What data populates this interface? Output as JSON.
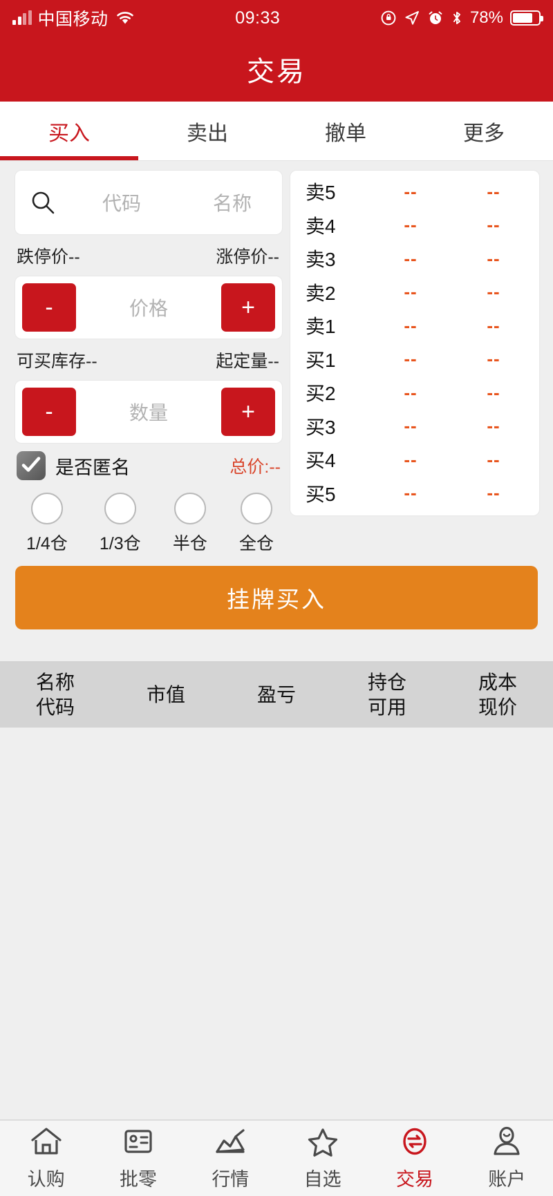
{
  "statusbar": {
    "carrier": "中国移动",
    "time": "09:33",
    "battery_pct": "78%",
    "icons": [
      "signal-icon",
      "wifi-icon",
      "rotation-lock-icon",
      "location-arrow-icon",
      "alarm-icon",
      "bluetooth-icon",
      "battery-icon"
    ]
  },
  "header": {
    "title": "交易"
  },
  "tabs": [
    {
      "label": "买入",
      "active": true
    },
    {
      "label": "卖出",
      "active": false
    },
    {
      "label": "撤单",
      "active": false
    },
    {
      "label": "更多",
      "active": false
    }
  ],
  "form": {
    "search": {
      "code_placeholder": "代码",
      "name_placeholder": "名称"
    },
    "limit_down_label": "跌停价--",
    "limit_up_label": "涨停价--",
    "price_stepper": {
      "minus": "-",
      "plus": "+",
      "placeholder": "价格"
    },
    "available_stock_label": "可买库存--",
    "min_order_label": "起定量--",
    "qty_stepper": {
      "minus": "-",
      "plus": "+",
      "placeholder": "数量"
    },
    "anonymous": {
      "label": "是否匿名",
      "checked": true
    },
    "total_price": "总价:--",
    "ratios": [
      {
        "label": "1/4仓"
      },
      {
        "label": "1/3仓"
      },
      {
        "label": "半仓"
      },
      {
        "label": "全仓"
      }
    ],
    "submit_label": "挂牌买入"
  },
  "orderbook": {
    "rows": [
      {
        "label": "卖5",
        "price": "--",
        "volume": "--"
      },
      {
        "label": "卖4",
        "price": "--",
        "volume": "--"
      },
      {
        "label": "卖3",
        "price": "--",
        "volume": "--"
      },
      {
        "label": "卖2",
        "price": "--",
        "volume": "--"
      },
      {
        "label": "卖1",
        "price": "--",
        "volume": "--"
      },
      {
        "label": "买1",
        "price": "--",
        "volume": "--"
      },
      {
        "label": "买2",
        "price": "--",
        "volume": "--"
      },
      {
        "label": "买3",
        "price": "--",
        "volume": "--"
      },
      {
        "label": "买4",
        "price": "--",
        "volume": "--"
      },
      {
        "label": "买5",
        "price": "--",
        "volume": "--"
      }
    ]
  },
  "positions_table": {
    "columns": [
      {
        "line1": "名称",
        "line2": "代码"
      },
      {
        "line1": "市值",
        "line2": ""
      },
      {
        "line1": "盈亏",
        "line2": ""
      },
      {
        "line1": "持仓",
        "line2": "可用"
      },
      {
        "line1": "成本",
        "line2": "现价"
      }
    ],
    "rows": []
  },
  "bottomnav": [
    {
      "label": "认购",
      "icon": "home-icon",
      "active": false
    },
    {
      "label": "批零",
      "icon": "id-card-icon",
      "active": false
    },
    {
      "label": "行情",
      "icon": "chart-line-icon",
      "active": false
    },
    {
      "label": "自选",
      "icon": "star-icon",
      "active": false
    },
    {
      "label": "交易",
      "icon": "exchange-icon",
      "active": true
    },
    {
      "label": "账户",
      "icon": "user-icon",
      "active": false
    }
  ],
  "colors": {
    "brand_red": "#C8161D",
    "accent_orange": "#E4821C",
    "quote_orange": "#E8551E",
    "page_bg": "#efefef",
    "table_head_bg": "#d4d4d4"
  }
}
